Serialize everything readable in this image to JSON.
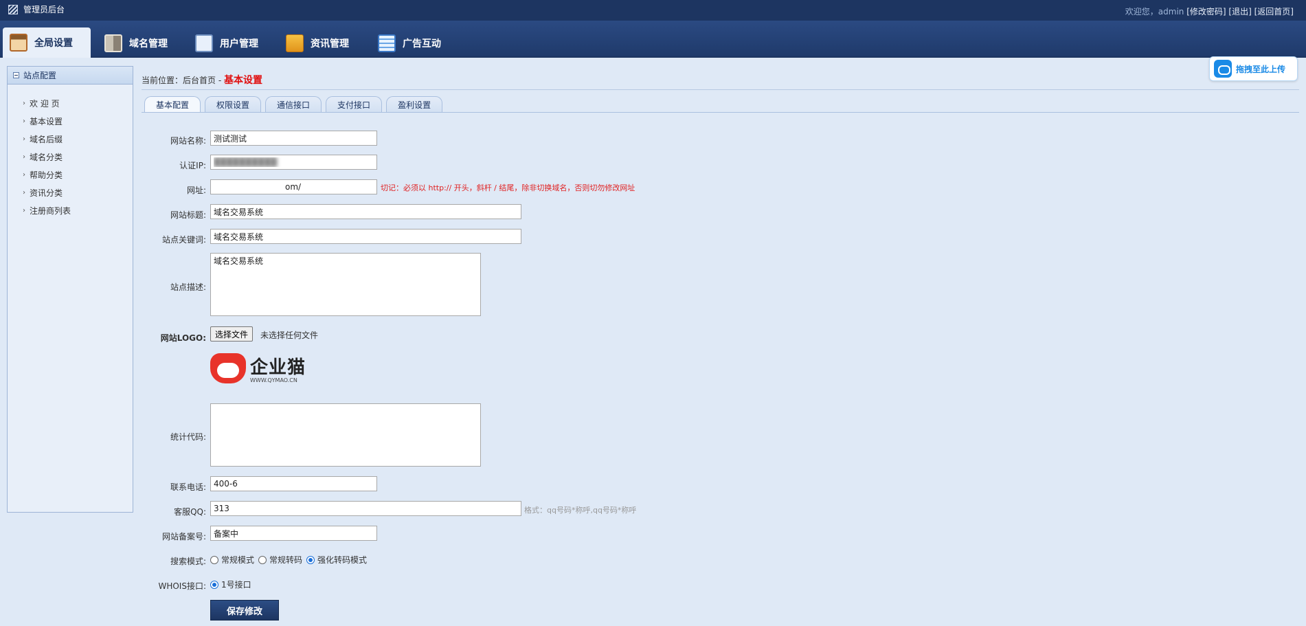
{
  "app": {
    "title": "管理员后台"
  },
  "userbar": {
    "welcome": "欢迎您，admin",
    "change_password": "[修改密码]",
    "logout": "[退出]",
    "home": "[返回首页]"
  },
  "nav": {
    "tabs": [
      {
        "label": "全局设置",
        "icon": "global-settings-icon",
        "active": true
      },
      {
        "label": "域名管理",
        "icon": "domain-grid-icon"
      },
      {
        "label": "用户管理",
        "icon": "user-card-icon"
      },
      {
        "label": "资讯管理",
        "icon": "news-box-icon"
      },
      {
        "label": "广告互动",
        "icon": "ad-list-icon"
      }
    ]
  },
  "sidebar": {
    "heading": "站点配置",
    "items": [
      {
        "label": "欢 迎 页"
      },
      {
        "label": "基本设置"
      },
      {
        "label": "域名后缀"
      },
      {
        "label": "域名分类"
      },
      {
        "label": "帮助分类"
      },
      {
        "label": "资讯分类"
      },
      {
        "label": "注册商列表"
      }
    ]
  },
  "breadcrumb": {
    "prefix": "当前位置：后台首页 - ",
    "current": "基本设置"
  },
  "upload": {
    "label": "拖拽至此上传",
    "icon": "cloud-upload-icon"
  },
  "subtabs": [
    {
      "label": "基本配置",
      "active": true
    },
    {
      "label": "权限设置"
    },
    {
      "label": "通信接口"
    },
    {
      "label": "支付接口"
    },
    {
      "label": "盈利设置"
    }
  ],
  "form": {
    "site_name": {
      "label": "网站名称:",
      "value": "测试测试"
    },
    "auth_ip": {
      "label": "认证IP:",
      "value": "██████████"
    },
    "url": {
      "label": "网址:",
      "value": "om/",
      "hint": "切记：必须以 http:// 开头，斜杆 / 结尾，除非切换域名，否则切勿修改网址"
    },
    "site_title": {
      "label": "网站标题:",
      "value": "域名交易系统"
    },
    "keywords": {
      "label": "站点关键词:",
      "value": "域名交易系统"
    },
    "description": {
      "label": "站点描述:",
      "value": "域名交易系统"
    },
    "logo": {
      "label": "网站LOGO:",
      "button": "选择文件",
      "status": "未选择任何文件",
      "logo_text": "企业猫",
      "logo_sub": "WWW.QYMAO.CN"
    },
    "stats_code": {
      "label": "统计代码:",
      "value": ""
    },
    "phone": {
      "label": "联系电话:",
      "value": "400-6"
    },
    "qq": {
      "label": "客服QQ:",
      "value": "313",
      "hint": "格式：qq号码*称呼,qq号码*称呼"
    },
    "icp": {
      "label": "网站备案号:",
      "value": "备案中"
    },
    "search_mode": {
      "label": "搜索模式:",
      "options": [
        "常规模式",
        "常规转码",
        "强化转码模式"
      ],
      "selected": 2
    },
    "whois": {
      "label": "WHOIS接口:",
      "options": [
        "1号接口"
      ],
      "selected": 0
    },
    "save": "保存修改"
  }
}
